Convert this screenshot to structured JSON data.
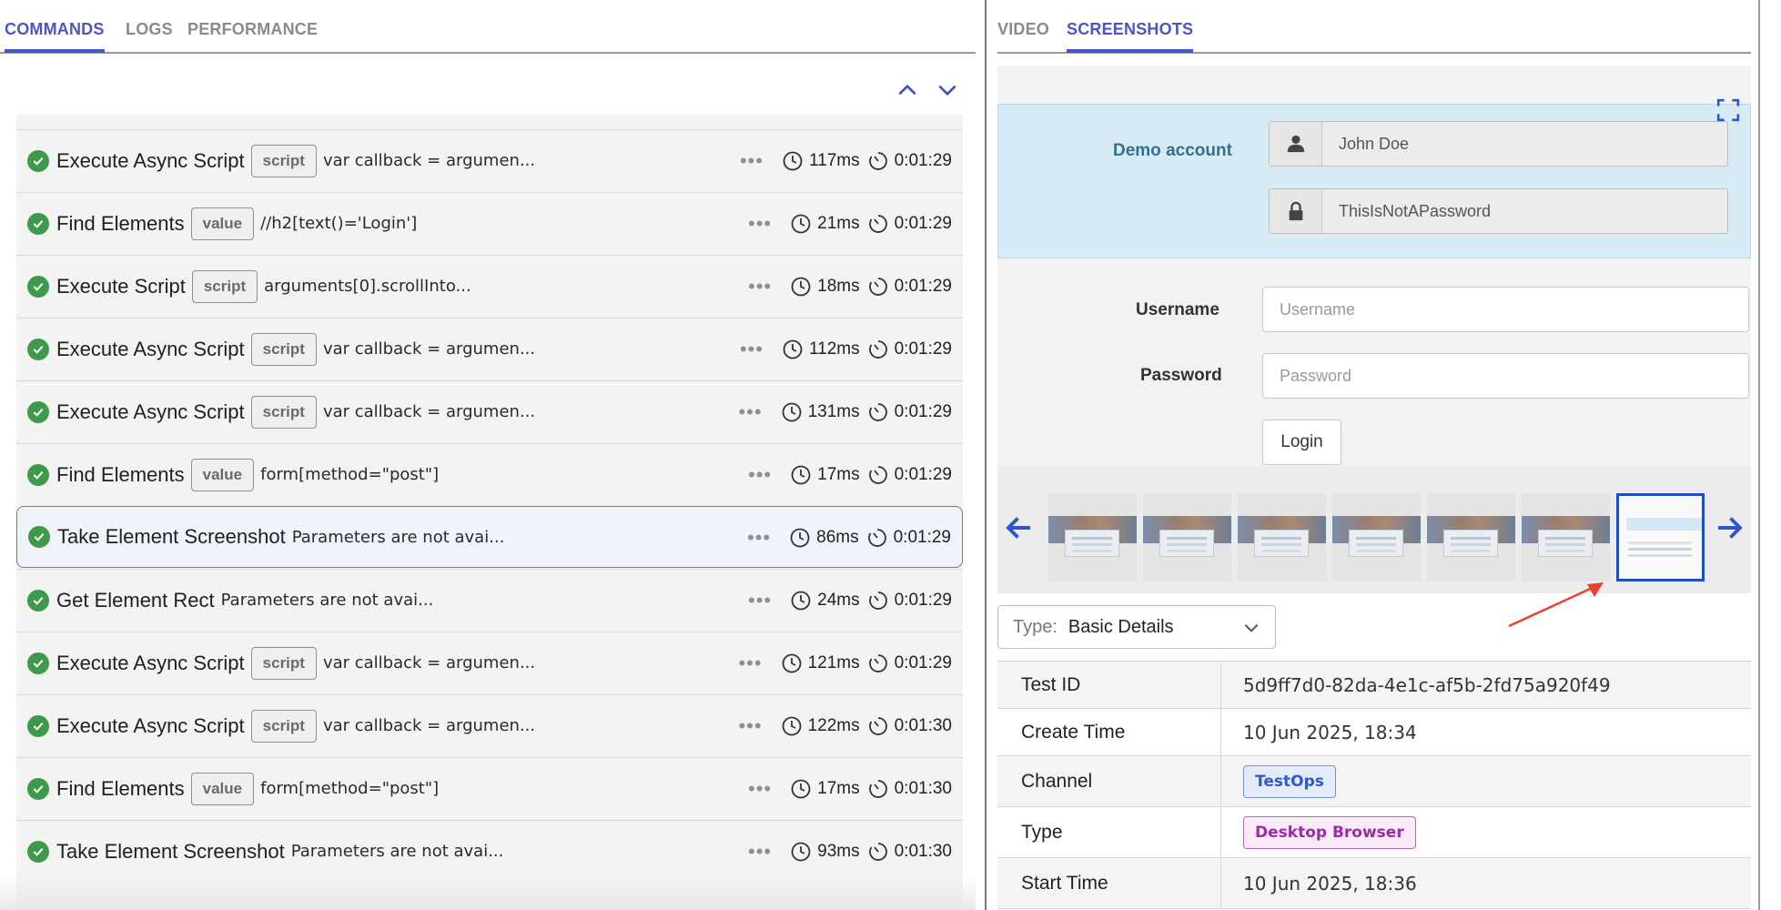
{
  "left_tabs": [
    {
      "label": "COMMANDS",
      "active": true
    },
    {
      "label": "LOGS",
      "active": false
    },
    {
      "label": "PERFORMANCE",
      "active": false
    }
  ],
  "commands": [
    {
      "name": "Execute Async Script",
      "tag": "script",
      "param": "var callback = argumen...",
      "duration": "117ms",
      "time": "0:01:29",
      "selected": false
    },
    {
      "name": "Find Elements",
      "tag": "value",
      "param": "//h2[text()='Login']",
      "duration": "21ms",
      "time": "0:01:29",
      "selected": false
    },
    {
      "name": "Execute Script",
      "tag": "script",
      "param": "arguments[0].scrollInto...",
      "duration": "18ms",
      "time": "0:01:29",
      "selected": false
    },
    {
      "name": "Execute Async Script",
      "tag": "script",
      "param": "var callback = argumen...",
      "duration": "112ms",
      "time": "0:01:29",
      "selected": false
    },
    {
      "name": "Execute Async Script",
      "tag": "script",
      "param": "var callback = argumen...",
      "duration": "131ms",
      "time": "0:01:29",
      "selected": false
    },
    {
      "name": "Find Elements",
      "tag": "value",
      "param": "form[method=\"post\"]",
      "duration": "17ms",
      "time": "0:01:29",
      "selected": false
    },
    {
      "name": "Take Element Screenshot",
      "tag": "",
      "param": "Parameters are not avai...",
      "duration": "86ms",
      "time": "0:01:29",
      "selected": true
    },
    {
      "name": "Get Element Rect",
      "tag": "",
      "param": "Parameters are not avai...",
      "duration": "24ms",
      "time": "0:01:29",
      "selected": false
    },
    {
      "name": "Execute Async Script",
      "tag": "script",
      "param": "var callback = argumen...",
      "duration": "121ms",
      "time": "0:01:29",
      "selected": false
    },
    {
      "name": "Execute Async Script",
      "tag": "script",
      "param": "var callback = argumen...",
      "duration": "122ms",
      "time": "0:01:30",
      "selected": false
    },
    {
      "name": "Find Elements",
      "tag": "value",
      "param": "form[method=\"post\"]",
      "duration": "17ms",
      "time": "0:01:30",
      "selected": false
    },
    {
      "name": "Take Element Screenshot",
      "tag": "",
      "param": "Parameters are not avai...",
      "duration": "93ms",
      "time": "0:01:30",
      "selected": false
    }
  ],
  "right_tabs": [
    {
      "label": "VIDEO",
      "active": false
    },
    {
      "label": "SCREENSHOTS",
      "active": true
    }
  ],
  "screenshot": {
    "demo_label": "Demo account",
    "demo_username": "John Doe",
    "demo_password": "ThisIsNotAPassword",
    "username_label": "Username",
    "username_placeholder": "Username",
    "password_label": "Password",
    "password_placeholder": "Password",
    "login_label": "Login"
  },
  "thumbnails": {
    "count": 7,
    "active_index": 6
  },
  "type_select": {
    "label": "Type:",
    "value": "Basic Details"
  },
  "details": [
    {
      "key": "Test ID",
      "value": "5d9ff7d0-82da-4e1c-af5b-2fd75a920f49",
      "badge": ""
    },
    {
      "key": "Create Time",
      "value": "10 Jun 2025, 18:34",
      "badge": ""
    },
    {
      "key": "Channel",
      "value": "TestOps",
      "badge": "testops"
    },
    {
      "key": "Type",
      "value": "Desktop Browser",
      "badge": "desktop"
    },
    {
      "key": "Start Time",
      "value": "10 Jun 2025, 18:36",
      "badge": ""
    }
  ],
  "colors": {
    "accent": "#4a56c8",
    "success": "#3e9a4a",
    "annotation": "#e8412c"
  }
}
